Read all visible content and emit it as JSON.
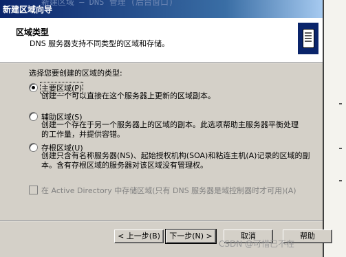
{
  "titlebar": {
    "title": "新建区域向导",
    "ghost_text": "新建区域 — DNS 管理 (后台窗口)"
  },
  "header": {
    "title": "区域类型",
    "subtitle": "DNS 服务器支持不同类型的区域和存储。",
    "icon": "server-icon"
  },
  "prompt": "选择您要创建的区域的类型:",
  "zone_types": [
    {
      "label": "主要区域(P)",
      "description": "创建一个可以直接在这个服务器上更新的区域副本。",
      "checked": true
    },
    {
      "label": "辅助区域(S)",
      "description": "创建一个存在于另一个服务器上的区域的副本。此选项帮助主服务器平衡处理的工作量，并提供容错。",
      "checked": false
    },
    {
      "label": "存根区域(U)",
      "description": "创建只含有名称服务器(NS)、起始授权机构(SOA)和粘连主机(A)记录的区域的副本。含有存根区域的服务器对该区域没有管理权。",
      "checked": false
    }
  ],
  "ad_option": {
    "label": "在 Active Directory 中存储区域(只有 DNS 服务器是域控制器时才可用)(A)",
    "enabled": false,
    "checked": false
  },
  "buttons": {
    "back": "< 上一步(B)",
    "next": "下一步(N) >",
    "cancel": "取消",
    "help": "帮助"
  },
  "watermark": "CSDN @可惜已不在",
  "colors": {
    "titlebar_start": "#0a246a",
    "titlebar_end": "#a6caf0",
    "dialog_face": "#d4d0c8",
    "disabled_text": "#808080"
  }
}
